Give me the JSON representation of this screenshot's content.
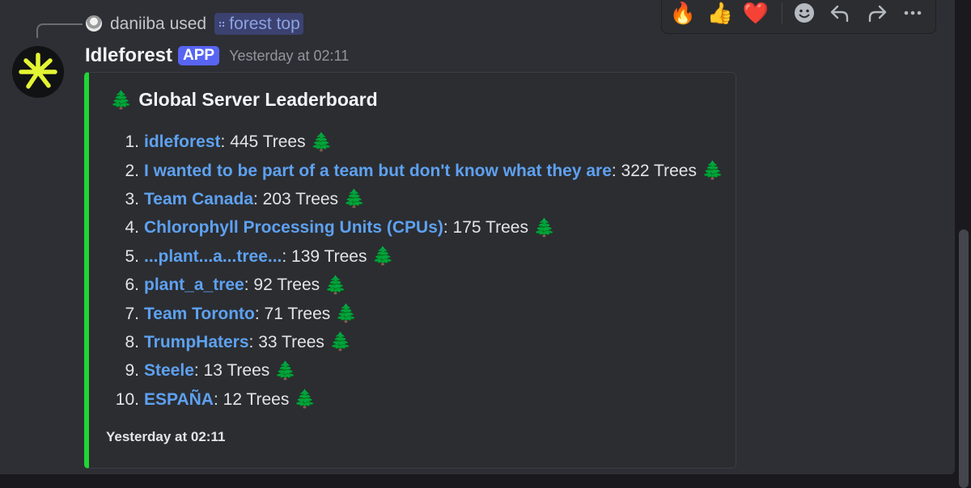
{
  "reply": {
    "user": "daniiba",
    "action": "used",
    "command": "forest top"
  },
  "author": {
    "name": "Idleforest",
    "badge": "APP",
    "timestamp": "Yesterday at 02:11"
  },
  "embed": {
    "title": "Global Server Leaderboard",
    "accent_color": "#1fd634",
    "leaderboard": [
      {
        "rank": "1.",
        "team": "idleforest",
        "trees": ": 445 Trees"
      },
      {
        "rank": "2.",
        "team": "I wanted to be part of a team but don't know what they are",
        "trees": ": 322 Trees"
      },
      {
        "rank": "3.",
        "team": "Team Canada",
        "trees": ": 203 Trees"
      },
      {
        "rank": "4.",
        "team": "Chlorophyll Processing Units (CPUs)",
        "trees": ": 175 Trees"
      },
      {
        "rank": "5.",
        "team": "...plant...a...tree...",
        "trees": ": 139 Trees"
      },
      {
        "rank": "6.",
        "team": "plant_a_tree",
        "trees": ": 92 Trees"
      },
      {
        "rank": "7.",
        "team": "Team Toronto",
        "trees": ": 71 Trees"
      },
      {
        "rank": "8.",
        "team": "TrumpHaters",
        "trees": ": 33 Trees"
      },
      {
        "rank": "9.",
        "team": "Steele",
        "trees": ": 13 Trees"
      },
      {
        "rank": "10.",
        "team": "ESPAÑA",
        "trees": ": 12 Trees"
      }
    ],
    "footer": "Yesterday at 02:11"
  },
  "toolbar": {
    "reactions": [
      "🔥",
      "👍",
      "❤️"
    ],
    "icons": [
      "add-reaction-icon",
      "reply-icon",
      "forward-icon",
      "more-icon"
    ]
  },
  "icons": {
    "tree": "🌲"
  },
  "colors": {
    "link": "#5ea1f0",
    "badge": "#5865f2"
  }
}
